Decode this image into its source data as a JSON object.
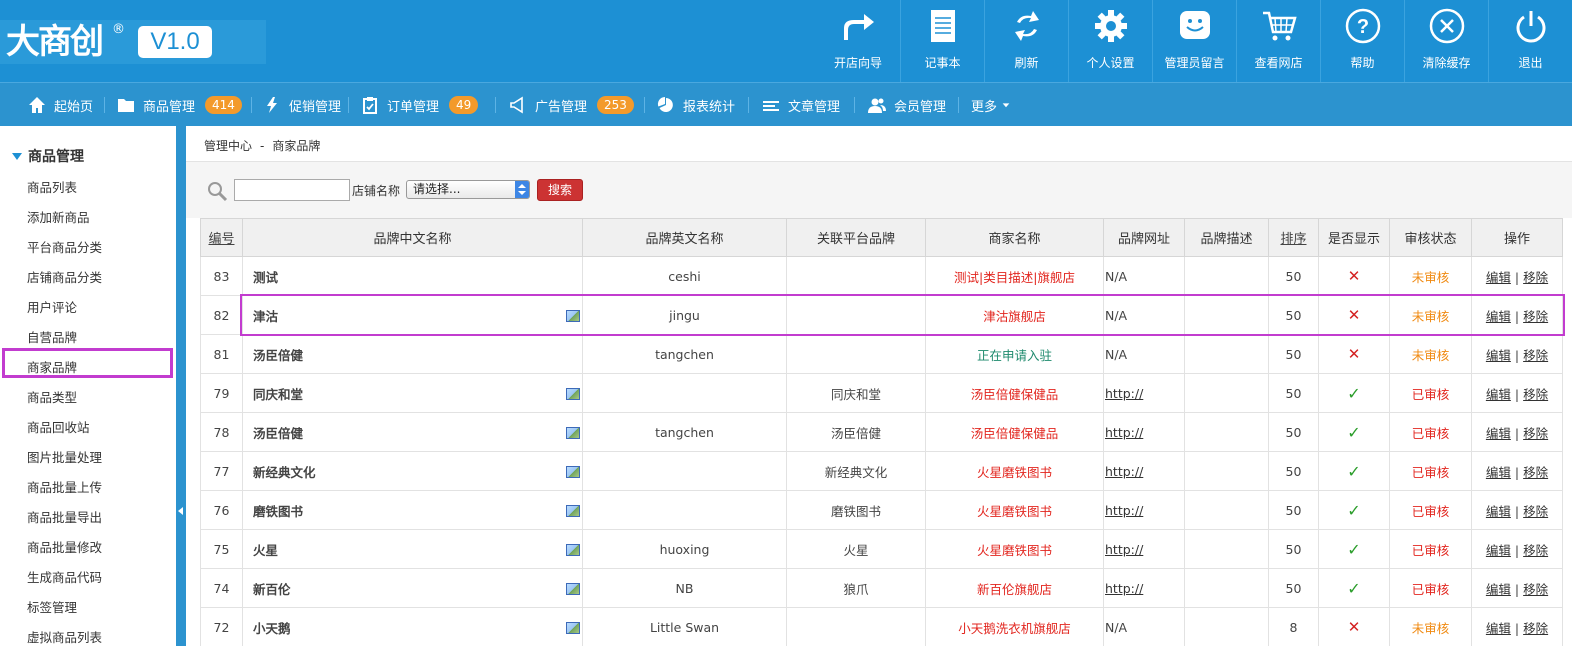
{
  "header": {
    "logo_text": "大商创",
    "logo_reg": "®",
    "version": "V1.0",
    "tools": [
      {
        "label": "开店向导",
        "icon": "share-arrow-icon"
      },
      {
        "label": "记事本",
        "icon": "notepad-icon"
      },
      {
        "label": "刷新",
        "icon": "refresh-icon"
      },
      {
        "label": "个人设置",
        "icon": "gear-icon"
      },
      {
        "label": "管理员留言",
        "icon": "smiley-message-icon"
      },
      {
        "label": "查看网店",
        "icon": "cart-icon"
      },
      {
        "label": "帮助",
        "icon": "help-icon"
      },
      {
        "label": "清除缓存",
        "icon": "clear-cache-icon"
      },
      {
        "label": "退出",
        "icon": "power-icon"
      }
    ]
  },
  "nav": {
    "items": [
      {
        "label": "起始页",
        "icon": "home-icon"
      },
      {
        "label": "商品管理",
        "icon": "folder-icon",
        "badge": "414"
      },
      {
        "label": "促销管理",
        "icon": "lightning-icon"
      },
      {
        "label": "订单管理",
        "icon": "clipboard-icon",
        "badge": "49"
      },
      {
        "label": "广告管理",
        "icon": "megaphone-icon",
        "badge": "253"
      },
      {
        "label": "报表统计",
        "icon": "pie-chart-icon"
      },
      {
        "label": "文章管理",
        "icon": "list-icon"
      },
      {
        "label": "会员管理",
        "icon": "users-icon"
      },
      {
        "label": "更多",
        "icon": "caret-down-icon"
      }
    ]
  },
  "sidebar": {
    "header": "商品管理",
    "items": [
      "商品列表",
      "添加新商品",
      "平台商品分类",
      "店铺商品分类",
      "用户评论",
      "自营品牌",
      "商家品牌",
      "商品类型",
      "商品回收站",
      "图片批量处理",
      "商品批量上传",
      "商品批量导出",
      "商品批量修改",
      "生成商品代码",
      "标签管理",
      "虚拟商品列表"
    ],
    "active_index": 6
  },
  "breadcrumb": {
    "root": "管理中心",
    "sep": "-",
    "current": "商家品牌"
  },
  "search": {
    "input_value": "",
    "store_label": "店铺名称",
    "select_value": "请选择...",
    "button": "搜索"
  },
  "table": {
    "columns": [
      "编号",
      "品牌中文名称",
      "品牌英文名称",
      "关联平台品牌",
      "商家名称",
      "品牌网址",
      "品牌描述",
      "排序",
      "是否显示",
      "审核状态",
      "操作"
    ],
    "edit_label": "编辑",
    "remove_label": "移除",
    "op_sep": "|",
    "rows": [
      {
        "id": "83",
        "cn": "测试",
        "img": false,
        "en": "ceshi",
        "platform": "",
        "shop": "测试|类目描述|旗舰店",
        "shop_color": "red",
        "url": "N/A",
        "desc": "",
        "sort": "50",
        "show": false,
        "status": "未审核"
      },
      {
        "id": "82",
        "cn": "津沽",
        "img": true,
        "en": "jingu",
        "platform": "",
        "shop": "津沽旗舰店",
        "shop_color": "red",
        "url": "N/A",
        "desc": "",
        "sort": "50",
        "show": false,
        "status": "未审核"
      },
      {
        "id": "81",
        "cn": "汤臣倍健",
        "img": false,
        "en": "tangchen",
        "platform": "",
        "shop": "正在申请入驻",
        "shop_color": "green",
        "url": "N/A",
        "desc": "",
        "sort": "50",
        "show": false,
        "status": "未审核"
      },
      {
        "id": "79",
        "cn": "同庆和堂",
        "img": true,
        "en": "",
        "platform": "同庆和堂",
        "shop": "汤臣倍健保健品",
        "shop_color": "red",
        "url": "http://",
        "desc": "",
        "sort": "50",
        "show": true,
        "status": "已审核"
      },
      {
        "id": "78",
        "cn": "汤臣倍健",
        "img": true,
        "en": "tangchen",
        "platform": "汤臣倍健",
        "shop": "汤臣倍健保健品",
        "shop_color": "red",
        "url": "http://",
        "desc": "",
        "sort": "50",
        "show": true,
        "status": "已审核"
      },
      {
        "id": "77",
        "cn": "新经典文化",
        "img": true,
        "en": "",
        "platform": "新经典文化",
        "shop": "火星磨铁图书",
        "shop_color": "red",
        "url": "http://",
        "desc": "",
        "sort": "50",
        "show": true,
        "status": "已审核"
      },
      {
        "id": "76",
        "cn": "磨铁图书",
        "img": true,
        "en": "",
        "platform": "磨铁图书",
        "shop": "火星磨铁图书",
        "shop_color": "red",
        "url": "http://",
        "desc": "",
        "sort": "50",
        "show": true,
        "status": "已审核"
      },
      {
        "id": "75",
        "cn": "火星",
        "img": true,
        "en": "huoxing",
        "platform": "火星",
        "shop": "火星磨铁图书",
        "shop_color": "red",
        "url": "http://",
        "desc": "",
        "sort": "50",
        "show": true,
        "status": "已审核"
      },
      {
        "id": "74",
        "cn": "新百伦",
        "img": true,
        "en": "NB",
        "platform": "狼爪",
        "shop": "新百伦旗舰店",
        "shop_color": "red",
        "url": "http://",
        "desc": "",
        "sort": "50",
        "show": true,
        "status": "已审核"
      },
      {
        "id": "72",
        "cn": "小天鹅",
        "img": true,
        "en": "Little Swan",
        "platform": "",
        "shop": "小天鹅洗衣机旗舰店",
        "shop_color": "red",
        "url": "N/A",
        "desc": "",
        "sort": "8",
        "show": false,
        "status": "未审核"
      }
    ]
  },
  "colors": {
    "header_bg": "#1d90d4",
    "nav_bg": "#2c93cf",
    "badge": "#f39a2b",
    "highlight": "#c23ccf",
    "shop_red": "#e2261f",
    "shop_green": "#1f8a6d",
    "status_pending": "#f08a12"
  }
}
